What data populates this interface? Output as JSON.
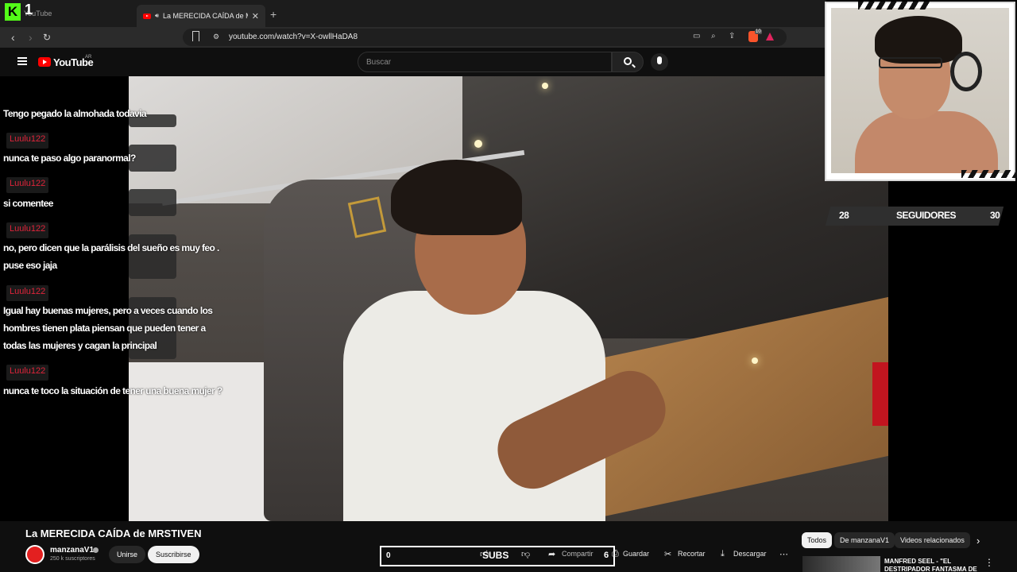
{
  "browser": {
    "kick_number": "1",
    "ghost_tab": "YouTube",
    "active_tab_title": "La MERECIDA CAÍDA de MRS",
    "url": "youtube.com/watch?v=X-owllHaDA8",
    "brave_badge": "10"
  },
  "youtube": {
    "logo_text": "YouTube",
    "country": "AR",
    "search_placeholder": "Buscar"
  },
  "chat": {
    "messages": [
      {
        "user": "",
        "text": "Tengo pegado la almohada todavia"
      },
      {
        "user": "Luulu122",
        "text": "nunca te paso algo paranormal?"
      },
      {
        "user": "Luulu122",
        "text": "si comentee"
      },
      {
        "user": "Luulu122",
        "text": "no, pero dicen que la parálisis del sueño es muy feo .",
        "text2": "puse eso jaja"
      },
      {
        "user": "Luulu122",
        "text": "Igual hay buenas mujeres, pero a veces cuando los",
        "text2": "hombres tienen plata piensan que pueden tener a",
        "text3": "todas las mujeres y cagan la principal"
      },
      {
        "user": "Luulu122",
        "text": "nunca te toco la situación de tener una buena mujer ?"
      }
    ]
  },
  "followers": {
    "current": "28",
    "label": "SEGUIDORES",
    "goal": "30"
  },
  "video": {
    "title": "La MERECIDA CAÍDA de MRSTIVEN",
    "channel": "manzanaV1",
    "subscribers": "250 k suscriptores",
    "join_label": "Unirse",
    "subscribe_label": "Suscribirse",
    "share_label": "Compartir",
    "save_label": "Guardar",
    "clip_label": "Recortar",
    "download_label": "Descargar"
  },
  "subs_goal": {
    "current": "0",
    "label": "SUBS",
    "goal": "6"
  },
  "chips": {
    "all": "Todos",
    "from_channel": "De manzanaV1",
    "related": "Videos relacionados"
  },
  "related_video": {
    "title": "MANFRED SEEL - \"EL DESTRIPADOR FANTASMA DE"
  }
}
